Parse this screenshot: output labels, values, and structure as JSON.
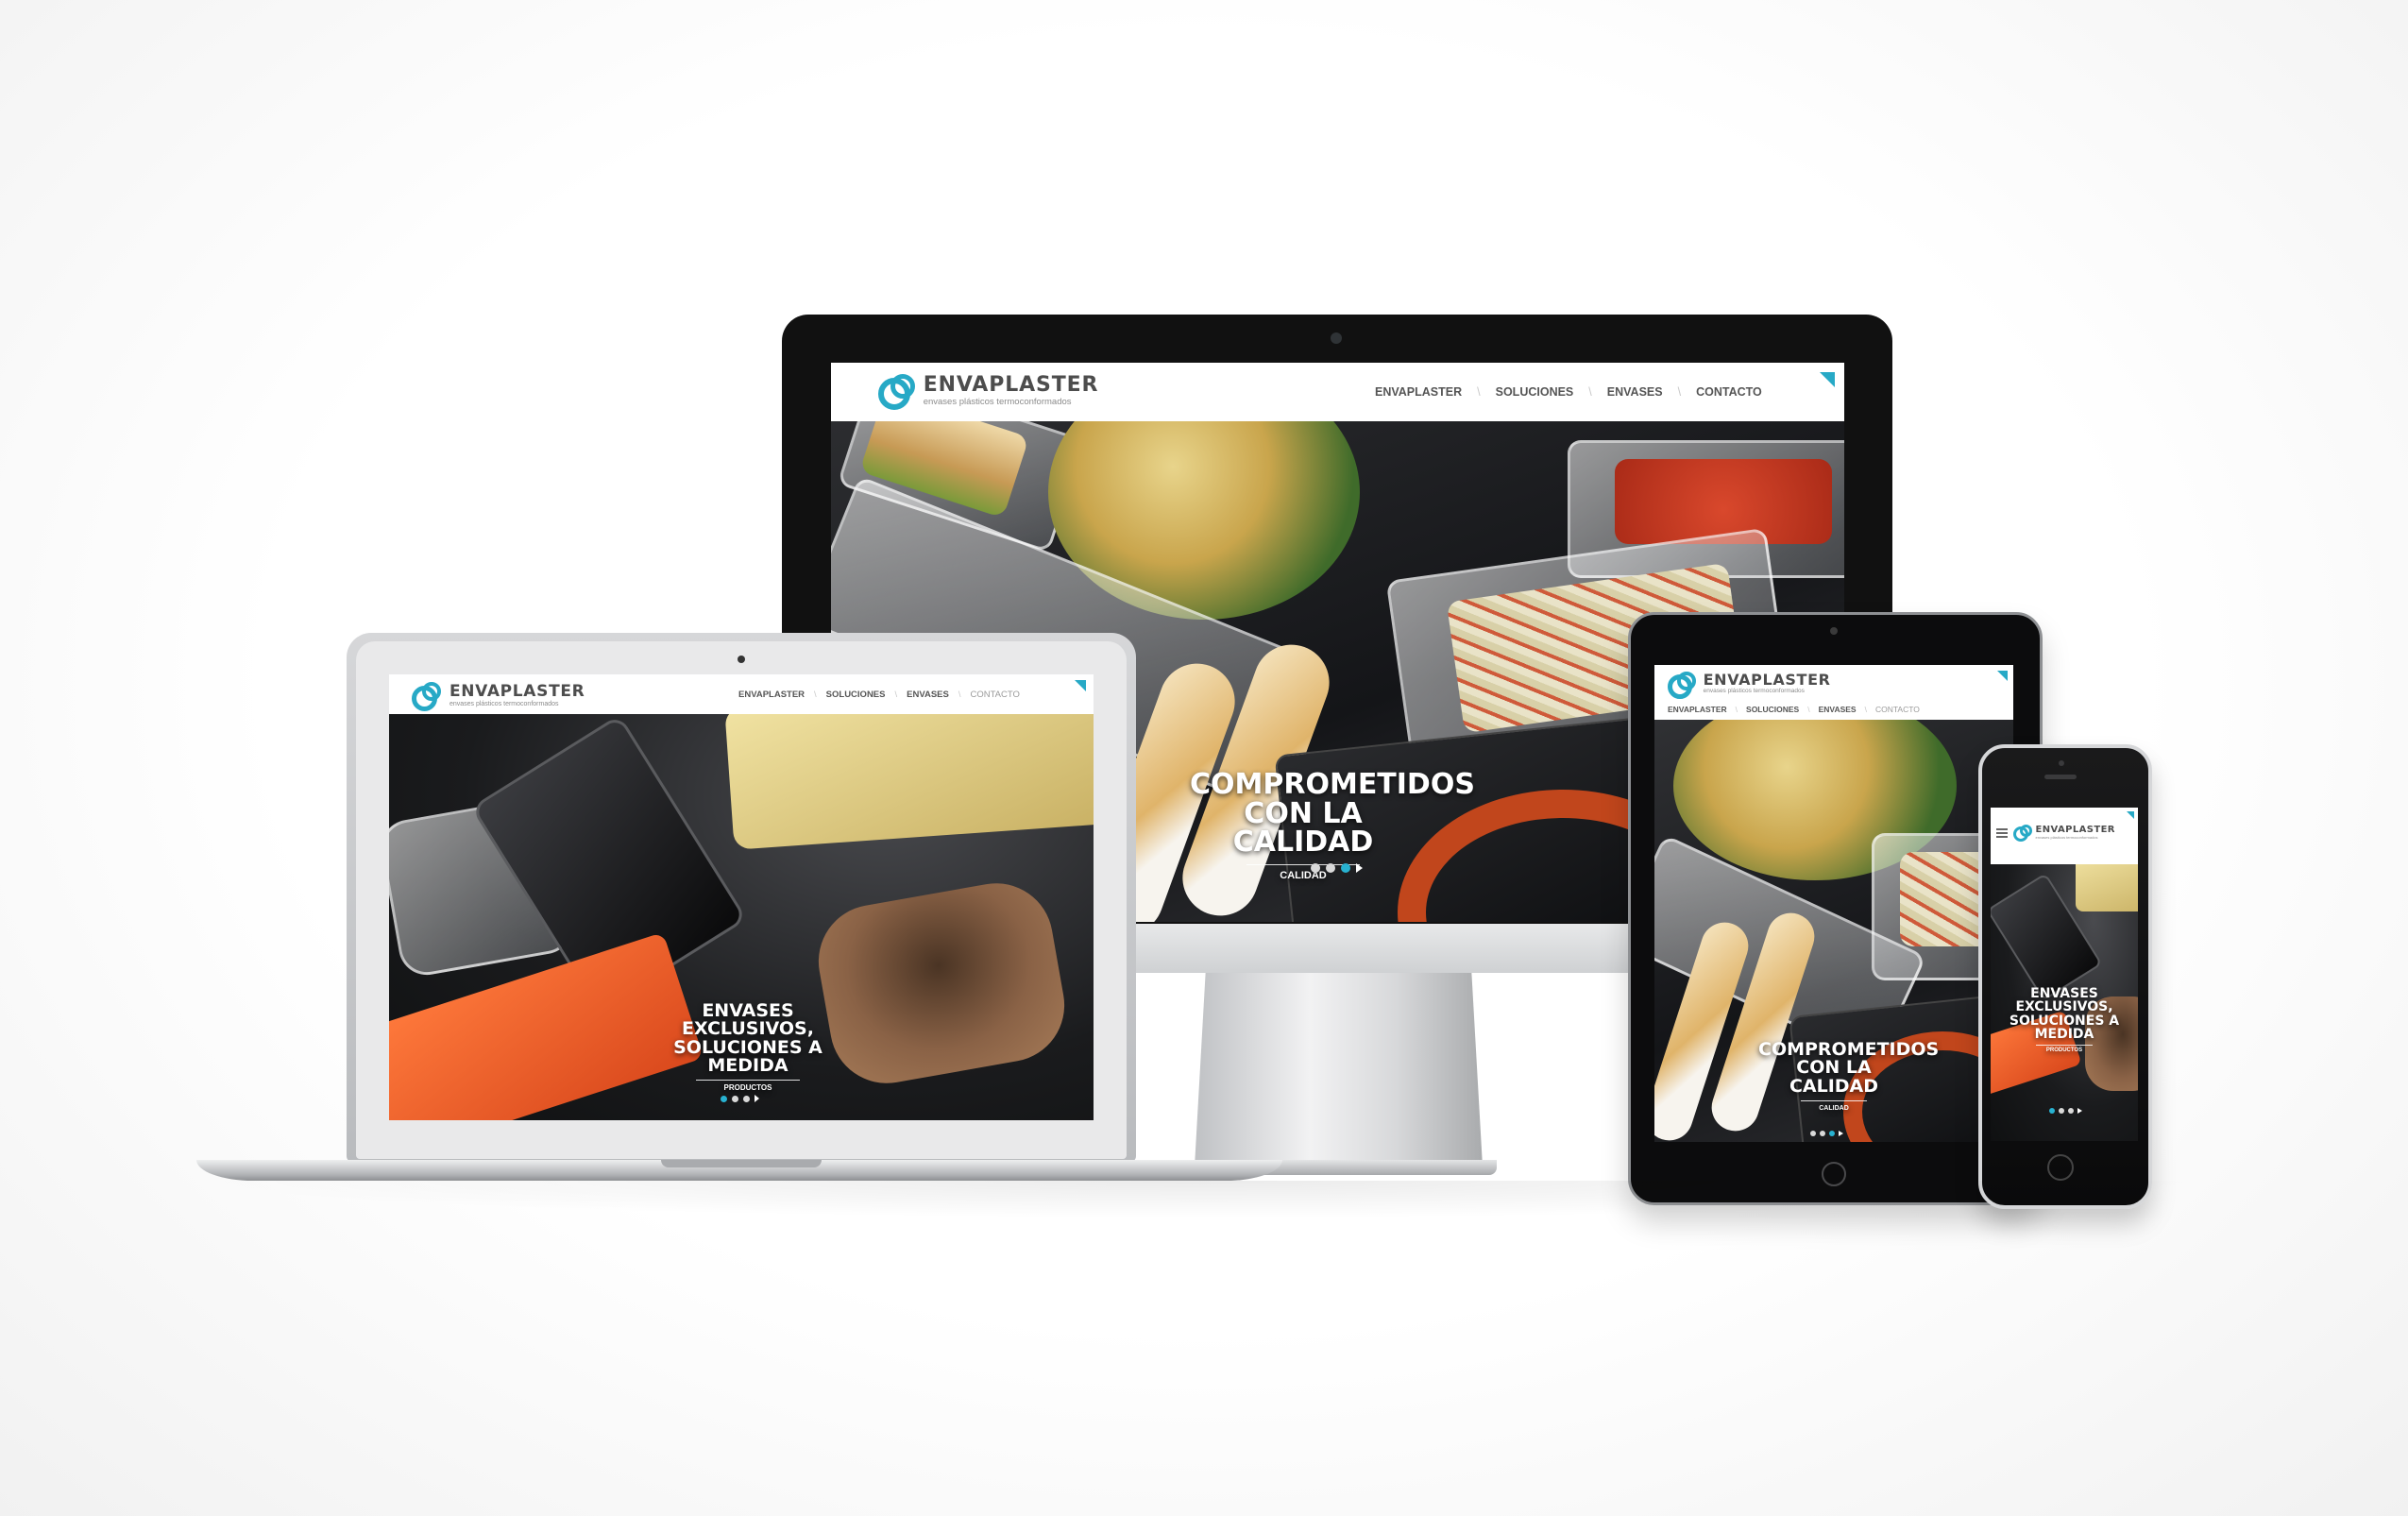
{
  "brand": {
    "name": "ENVAPLASTER",
    "tagline": "envases plásticos termoconformados"
  },
  "nav": {
    "items": [
      "ENVAPLASTER",
      "SOLUCIONES",
      "ENVASES",
      "CONTACTO"
    ]
  },
  "slides": {
    "calidad": {
      "line1": "COMPROMETIDOS",
      "line2": "CON LA CALIDAD",
      "sub": "CALIDAD"
    },
    "exclusivos": {
      "line1": "ENVASES EXCLUSIVOS,",
      "line2": "SOLUCIONES A MEDIDA",
      "sub": "PRODUCTOS"
    }
  },
  "colors": {
    "accent": "#27a9c6",
    "logo_text": "#4d4d4d",
    "nav_text": "#555555",
    "nav_dim": "#9a9a9a"
  },
  "icons": {
    "logo": "cp-monogram-icon",
    "menu": "hamburger-menu-icon",
    "slider_next": "play-arrow-icon",
    "home_button": "home-button-icon",
    "camera": "camera-icon"
  },
  "sliders": {
    "monitor": {
      "dots": 3,
      "active": 3
    },
    "laptop": {
      "dots": 3,
      "active": 1
    },
    "tablet": {
      "dots": 3,
      "active": 3
    },
    "phone": {
      "dots": 3,
      "active": 1
    }
  }
}
